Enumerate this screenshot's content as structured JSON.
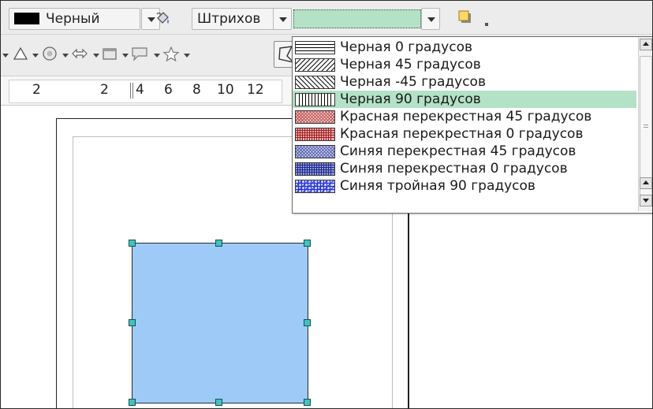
{
  "toolbar": {
    "line_color_label": "Черный",
    "area_style_label": "Штрихов",
    "fill_value": ""
  },
  "ruler": {
    "labels": [
      "2",
      "2",
      "4",
      "6",
      "8",
      "10",
      "12"
    ]
  },
  "dropdown": {
    "items": [
      {
        "label": "Черная 0 градусов",
        "pattern": "black-0"
      },
      {
        "label": "Черная 45 градусов",
        "pattern": "black-45"
      },
      {
        "label": "Черная -45 градусов",
        "pattern": "black-m45"
      },
      {
        "label": "Черная 90 градусов",
        "pattern": "black-90",
        "selected": true
      },
      {
        "label": "Красная перекрестная 45 градусов",
        "pattern": "red-cross-45"
      },
      {
        "label": "Красная перекрестная 0 градусов",
        "pattern": "red-cross-0"
      },
      {
        "label": "Синяя перекрестная 45 градусов",
        "pattern": "blue-cross-45"
      },
      {
        "label": "Синяя перекрестная 0 градусов",
        "pattern": "blue-cross-0"
      },
      {
        "label": "Синяя тройная 90 градусов",
        "pattern": "blue-triple-90"
      }
    ]
  },
  "colors": {
    "selection_highlight": "#b3e2c6",
    "shape_fill": "#9dcaf7",
    "handle": "#3fc3c3",
    "line_color_swatch": "#000000"
  }
}
